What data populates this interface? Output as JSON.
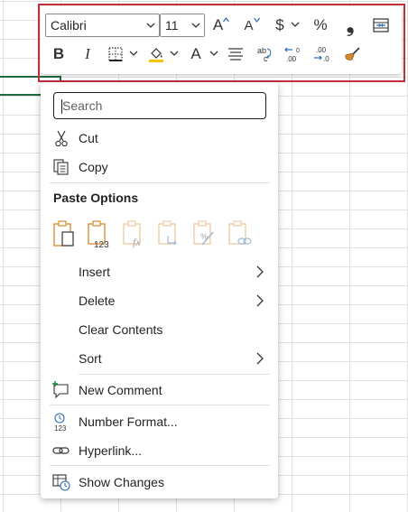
{
  "toolbar": {
    "font_name": "Calibri",
    "font_size": "11",
    "bold_label": "B",
    "italic_label": "I",
    "currency_label": "$",
    "percent_label": "%",
    "comma_label": "❟",
    "font_color_label": "A",
    "grow_font_label": "A",
    "shrink_font_label": "A"
  },
  "menu": {
    "search_placeholder": "Search",
    "cut": "Cut",
    "copy": "Copy",
    "paste_options": "Paste Options",
    "insert": "Insert",
    "delete": "Delete",
    "clear_contents": "Clear Contents",
    "sort": "Sort",
    "new_comment": "New Comment",
    "number_format": "Number Format...",
    "hyperlink": "Hyperlink...",
    "show_changes": "Show Changes"
  },
  "colors": {
    "accent_orange": "#d7892a",
    "accent_blue": "#2f6db5",
    "highlight_yellow": "#f5c400",
    "selection_red": "#c0303a",
    "active_cell_green": "#1f6b3f"
  }
}
